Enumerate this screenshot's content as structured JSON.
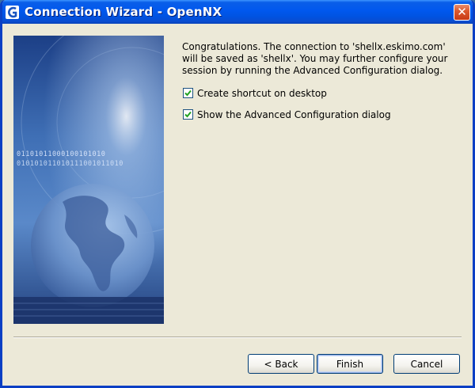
{
  "window": {
    "title": "Connection Wizard - OpenNX",
    "close_glyph": "✕"
  },
  "message": "Congratulations. The connection to 'shellx.eskimo.com' will be saved as 'shellx'. You may further configure your session by running the Advanced Configuration dialog.",
  "checkboxes": [
    {
      "label": "Create shortcut on desktop",
      "checked": true
    },
    {
      "label": "Show the Advanced Configuration dialog",
      "checked": true
    }
  ],
  "banner": {
    "binary_lines": [
      "01101011000100101010",
      "010101011010111001011010"
    ]
  },
  "buttons": {
    "back": "< Back",
    "finish": "Finish",
    "cancel": "Cancel"
  },
  "icons": {
    "app": "opennx-app-icon",
    "close": "close-icon",
    "check": "check-icon",
    "globe": "globe-icon"
  },
  "colors": {
    "titlebar": "#0058ee",
    "face": "#ece9d8",
    "banner_dark": "#1d3a7a",
    "banner_light": "#7fa6d8",
    "close": "#dc5a2f"
  }
}
